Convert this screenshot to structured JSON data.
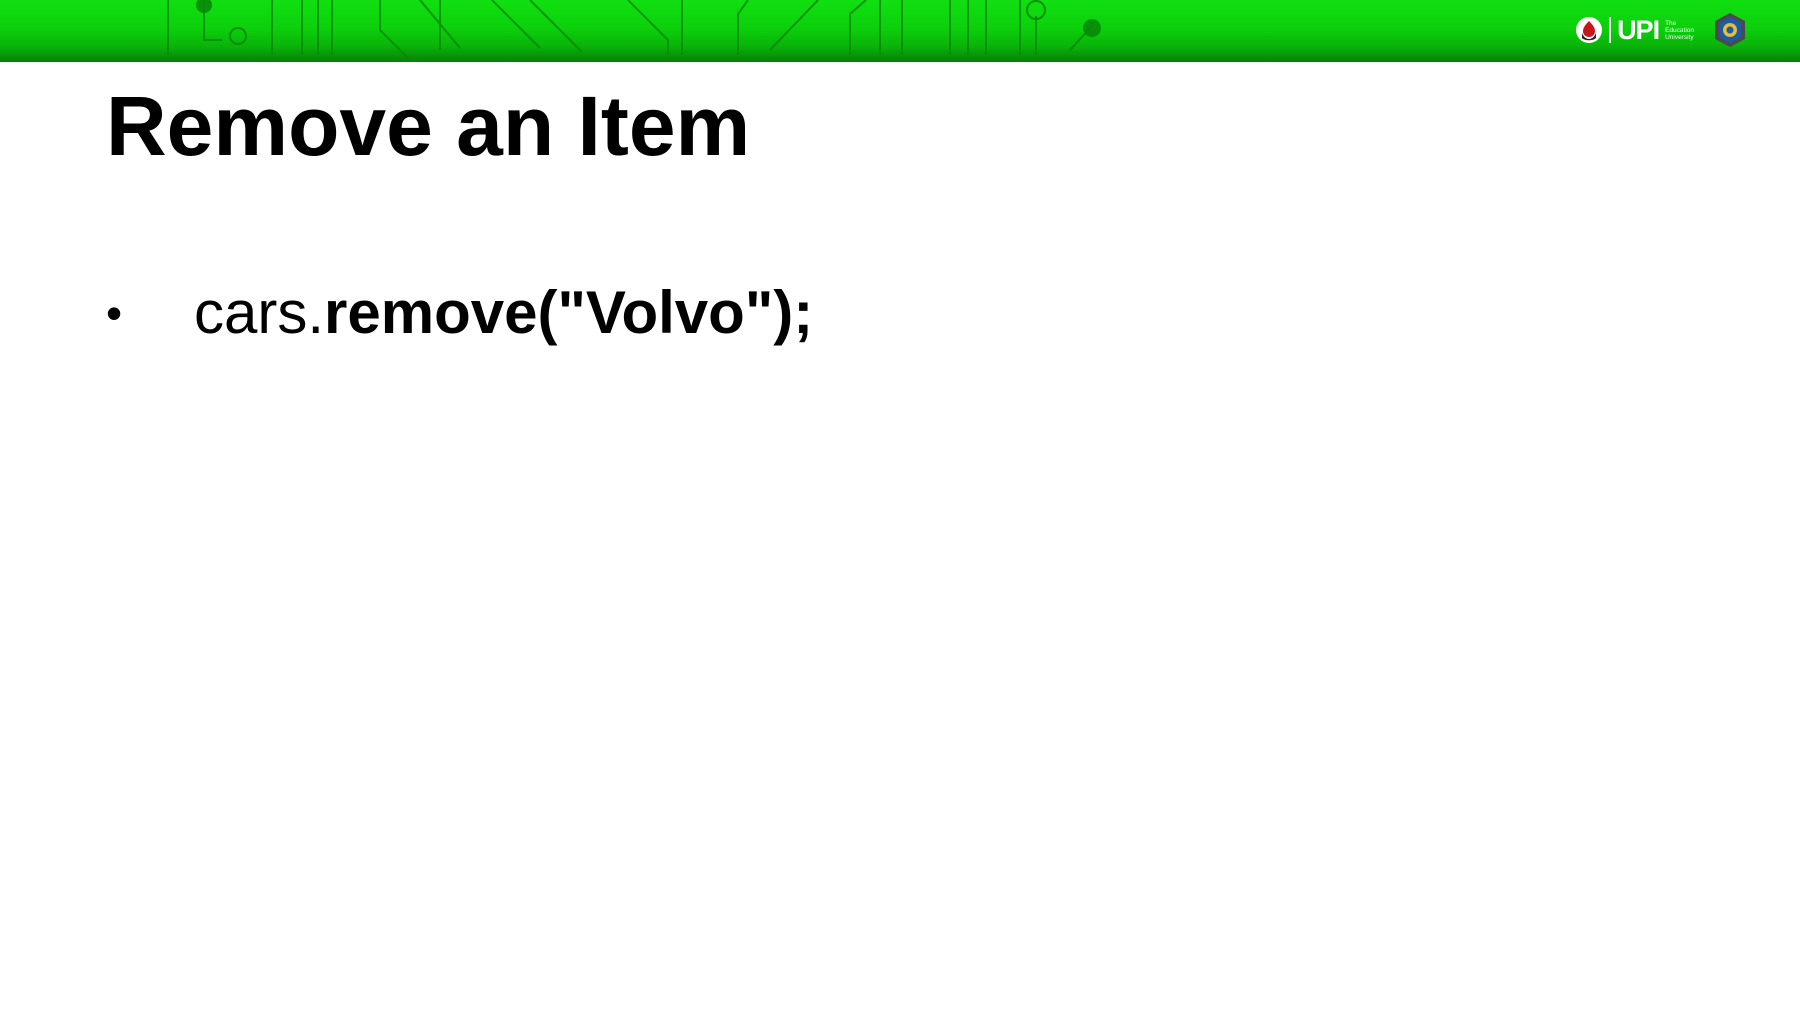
{
  "header": {
    "logo_text": "UPI",
    "logo_tagline": [
      "The",
      "Education",
      "University"
    ],
    "banner_color": "#0cd00c"
  },
  "slide": {
    "title": "Remove an Item",
    "bullets": [
      {
        "marker": "•",
        "text_plain": "cars.",
        "text_bold": "remove(\"Volvo\");"
      }
    ]
  }
}
